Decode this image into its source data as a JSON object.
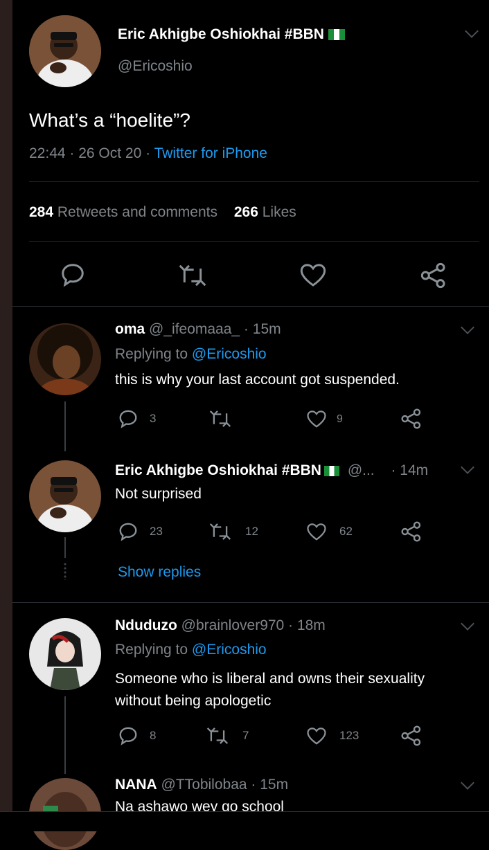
{
  "main_tweet": {
    "author_name": "Eric Akhigbe Oshiokhai #BBN",
    "handle": "@Ericoshio",
    "text": "What’s a “hoelite”?",
    "time_date": "22:44 · 26 Oct 20 · ",
    "source": "Twitter for iPhone",
    "retweets_count": "284",
    "retweets_label": "Retweets and comments",
    "likes_count": "266",
    "likes_label": "Likes"
  },
  "replies": [
    {
      "name": "oma",
      "handle": "@_ifeomaaa_ · 15m",
      "replying_prefix": "Replying to ",
      "replying_to": "@Ericoshio",
      "text": "this is why your last account got suspended.",
      "reply_count": "3",
      "retweet_count": "",
      "like_count": "9"
    },
    {
      "name": "Eric Akhigbe Oshiokhai #BBN",
      "handle": "@...",
      "time": "· 14m",
      "text": "Not surprised",
      "reply_count": "23",
      "retweet_count": "12",
      "like_count": "62",
      "show_replies": "Show replies"
    },
    {
      "name": "Nduduzo",
      "handle": "@brainlover970 · 18m",
      "replying_prefix": "Replying to ",
      "replying_to": "@Ericoshio",
      "text_line1": "Someone who is liberal and owns their sexuality",
      "text_line2": "without being apologetic",
      "reply_count": "8",
      "retweet_count": "7",
      "like_count": "123"
    },
    {
      "name": "NANA",
      "handle": "@TTobilobaa · 15m",
      "text": "Na ashawo wey go school"
    }
  ],
  "colors": {
    "background": "#000000",
    "accent": "#1d9bf0",
    "muted": "#7f858a"
  }
}
